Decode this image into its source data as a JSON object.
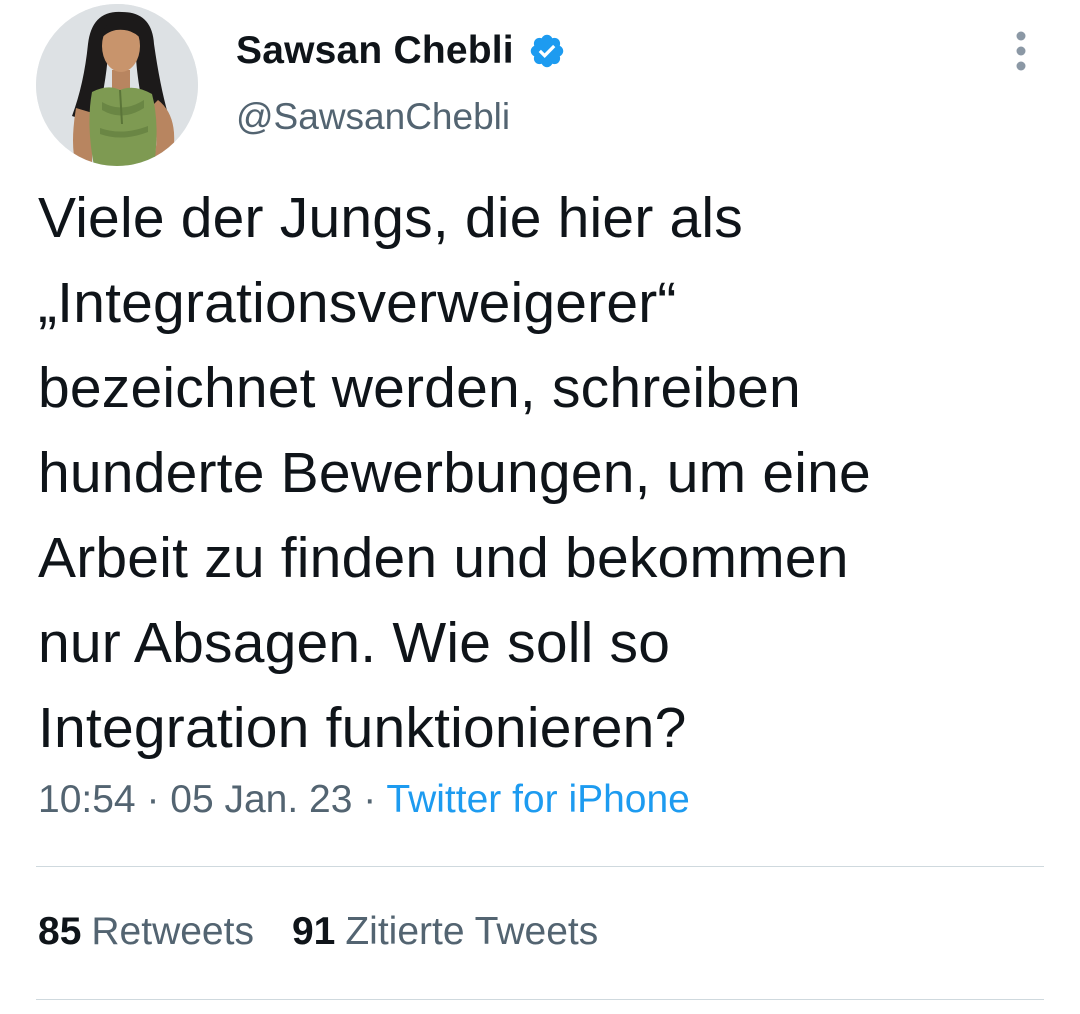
{
  "user": {
    "display_name": "Sawsan Chebli",
    "handle": "@SawsanChebli",
    "verified": true,
    "verified_color": "#1d9bf0"
  },
  "tweet": {
    "text": "Viele der Jungs, die hier als\n„Integrationsverweigerer“\nbezeichnet werden, schreiben\nhunderte Bewerbungen, um eine\nArbeit zu finden und bekommen\nnur Absagen. Wie soll so\nIntegration funktionieren?",
    "time": "10:54",
    "separator": "·",
    "date": "05 Jan. 23",
    "source": "Twitter for iPhone"
  },
  "stats": {
    "retweets_count": "85",
    "retweets_label": "Retweets",
    "quotes_count": "91",
    "quotes_label": "Zitierte Tweets"
  },
  "icons": {
    "verified": "verified-badge-icon",
    "more": "more-vertical-icon"
  },
  "colors": {
    "text_primary": "#0f1419",
    "text_secondary": "#536471",
    "link": "#1d9bf0",
    "divider": "#cfd9de"
  }
}
